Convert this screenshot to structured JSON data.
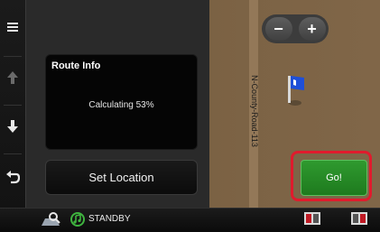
{
  "route_info": {
    "title": "Route Info",
    "status": "Calculating 53%"
  },
  "buttons": {
    "set_location": "Set Location",
    "go": "Go!",
    "zoom_out": "−",
    "zoom_in": "+"
  },
  "map": {
    "road_label": "N-County-Road-113"
  },
  "status_bar": {
    "source": "STANDBY"
  },
  "sidebar": {
    "items": [
      "menu-icon",
      "arrow-up-icon",
      "arrow-down-icon",
      "back-icon"
    ]
  },
  "colors": {
    "accent_green": "#2f9a2f",
    "highlight_red": "#e01b2d",
    "map_land": "#7b6244"
  }
}
